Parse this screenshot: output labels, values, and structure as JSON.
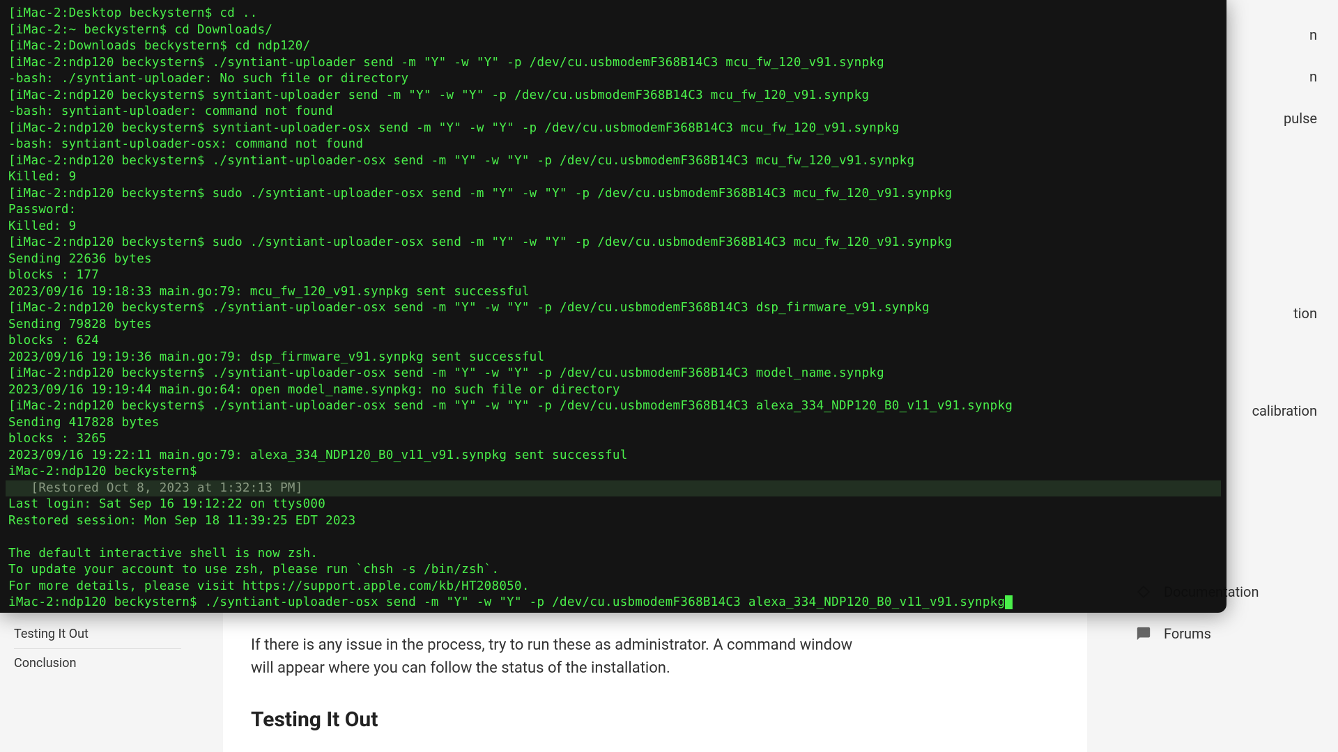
{
  "terminal": {
    "lines": [
      "[iMac-2:Desktop beckystern$ cd ..",
      "[iMac-2:~ beckystern$ cd Downloads/",
      "[iMac-2:Downloads beckystern$ cd ndp120/",
      "[iMac-2:ndp120 beckystern$ ./syntiant-uploader send -m \"Y\" -w \"Y\" -p /dev/cu.usbmodemF368B14C3 mcu_fw_120_v91.synpkg",
      "-bash: ./syntiant-uploader: No such file or directory",
      "[iMac-2:ndp120 beckystern$ syntiant-uploader send -m \"Y\" -w \"Y\" -p /dev/cu.usbmodemF368B14C3 mcu_fw_120_v91.synpkg",
      "-bash: syntiant-uploader: command not found",
      "[iMac-2:ndp120 beckystern$ syntiant-uploader-osx send -m \"Y\" -w \"Y\" -p /dev/cu.usbmodemF368B14C3 mcu_fw_120_v91.synpkg",
      "-bash: syntiant-uploader-osx: command not found",
      "[iMac-2:ndp120 beckystern$ ./syntiant-uploader-osx send -m \"Y\" -w \"Y\" -p /dev/cu.usbmodemF368B14C3 mcu_fw_120_v91.synpkg",
      "Killed: 9",
      "[iMac-2:ndp120 beckystern$ sudo ./syntiant-uploader-osx send -m \"Y\" -w \"Y\" -p /dev/cu.usbmodemF368B14C3 mcu_fw_120_v91.synpkg",
      "Password:",
      "Killed: 9",
      "[iMac-2:ndp120 beckystern$ sudo ./syntiant-uploader-osx send -m \"Y\" -w \"Y\" -p /dev/cu.usbmodemF368B14C3 mcu_fw_120_v91.synpkg",
      "Sending 22636 bytes",
      "blocks : 177",
      "2023/09/16 19:18:33 main.go:79: mcu_fw_120_v91.synpkg sent successful",
      "[iMac-2:ndp120 beckystern$ ./syntiant-uploader-osx send -m \"Y\" -w \"Y\" -p /dev/cu.usbmodemF368B14C3 dsp_firmware_v91.synpkg",
      "Sending 79828 bytes",
      "blocks : 624",
      "2023/09/16 19:19:36 main.go:79: dsp_firmware_v91.synpkg sent successful",
      "[iMac-2:ndp120 beckystern$ ./syntiant-uploader-osx send -m \"Y\" -w \"Y\" -p /dev/cu.usbmodemF368B14C3 model_name.synpkg",
      "2023/09/16 19:19:44 main.go:64: open model_name.synpkg: no such file or directory",
      "[iMac-2:ndp120 beckystern$ ./syntiant-uploader-osx send -m \"Y\" -w \"Y\" -p /dev/cu.usbmodemF368B14C3 alexa_334_NDP120_B0_v11_v91.synpkg",
      "Sending 417828 bytes",
      "blocks : 3265",
      "2023/09/16 19:22:11 main.go:79: alexa_334_NDP120_B0_v11_v91.synpkg sent successful",
      "iMac-2:ndp120 beckystern$"
    ],
    "restored_label": "   [Restored Oct 8, 2023 at 1:32:13 PM]",
    "after_lines": [
      "Last login: Sat Sep 16 19:12:22 on ttys000",
      "Restored session: Mon Sep 18 11:39:25 EDT 2023",
      "",
      "The default interactive shell is now zsh.",
      "To update your account to use zsh, please run `chsh -s /bin/zsh`.",
      "For more details, please visit https://support.apple.com/kb/HT208050."
    ],
    "last_prompt": "iMac-2:ndp120 beckystern$ ./syntiant-uploader-osx send -m \"Y\" -w \"Y\" -p /dev/cu.usbmodemF368B14C3 alexa_334_NDP120_B0_v11_v91.synpkg"
  },
  "sidebar_left": {
    "items": [
      "Testing It Out",
      "Conclusion"
    ]
  },
  "article": {
    "body": "If there is any issue in the process, try to run these as administrator. A command window will appear where you can follow the status of the installation.",
    "heading": "Testing It Out"
  },
  "sidebar_right": {
    "partial_items": [
      "n",
      "n",
      "pulse",
      "tion",
      "calibration"
    ],
    "items": [
      {
        "label": "Documentation"
      },
      {
        "label": "Forums"
      }
    ]
  }
}
